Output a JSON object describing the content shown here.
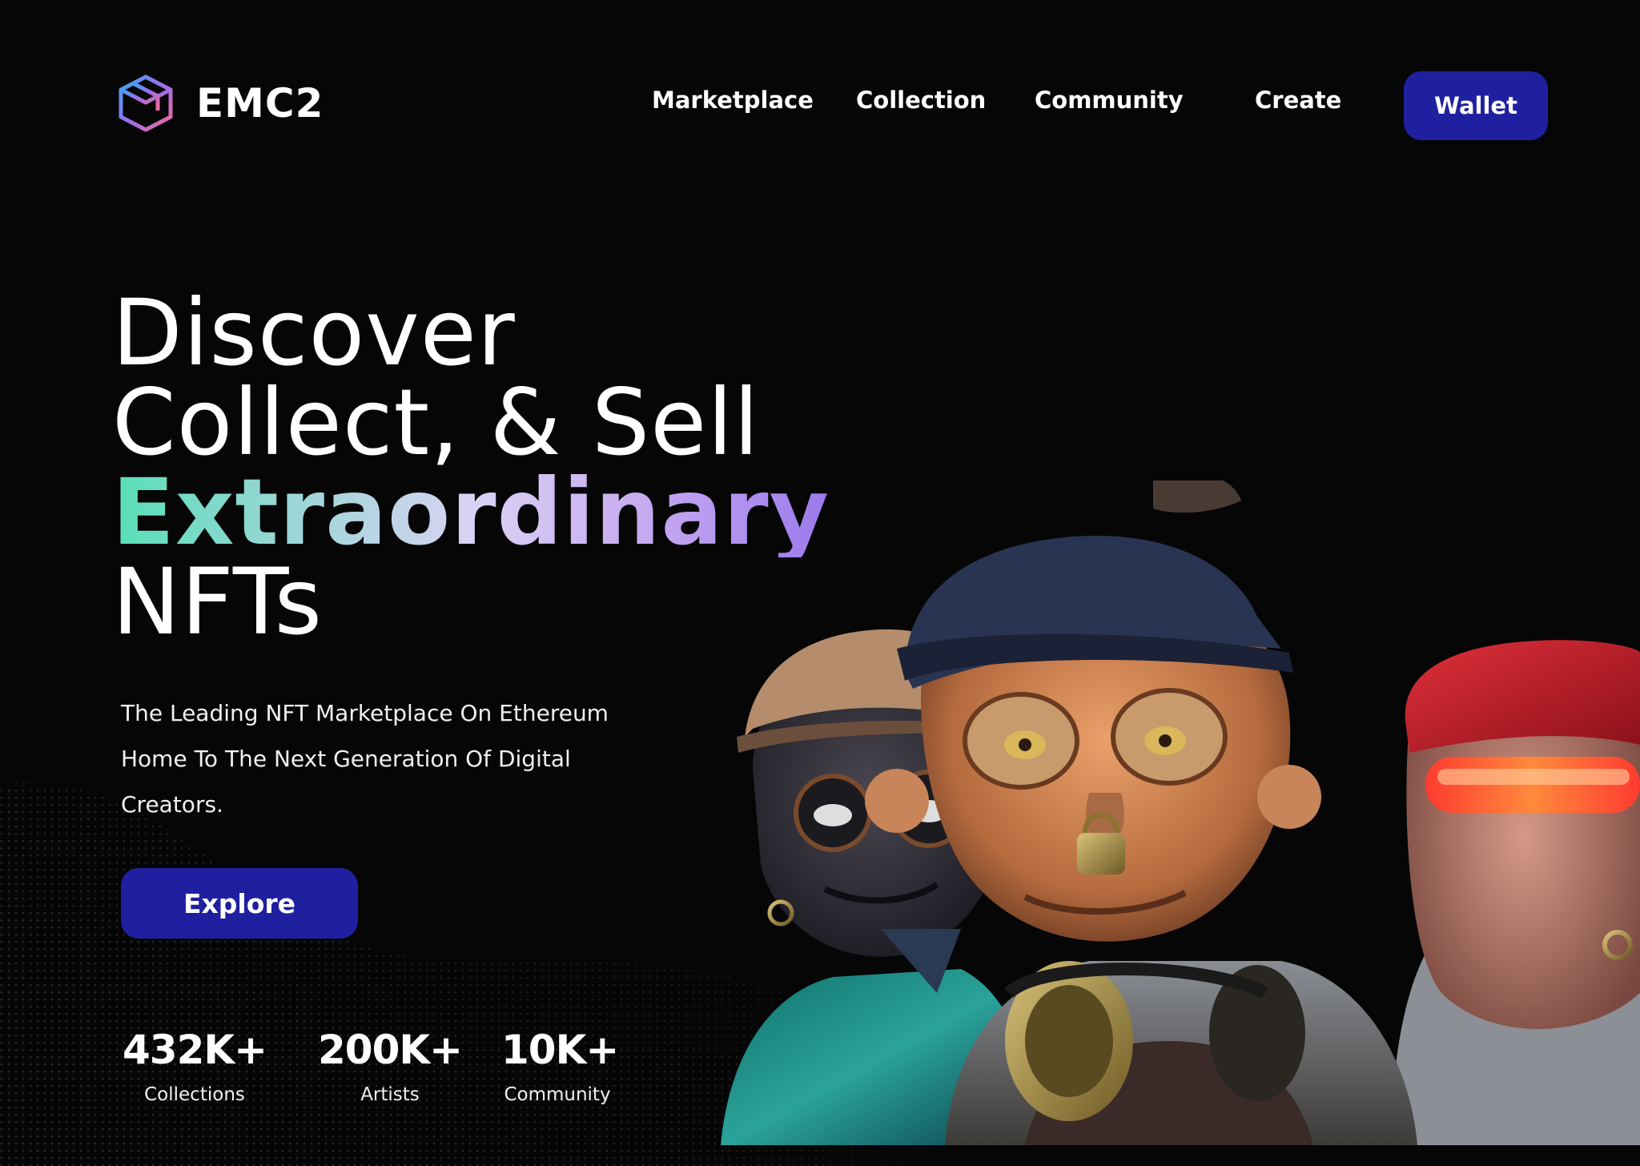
{
  "brand": {
    "name": "EMC2",
    "logo_icon": "isometric-cube-logo",
    "gradient": [
      "#3ba5f5",
      "#c25ae8",
      "#f36a9b"
    ]
  },
  "nav": {
    "items": [
      "Marketplace",
      "Collection",
      "Community",
      "Create"
    ],
    "wallet_label": "Wallet"
  },
  "hero": {
    "title_lines": [
      "Discover",
      "Collect, & Sell",
      "Extraordinary",
      "NFTs"
    ],
    "subtitle_lines": [
      "The Leading NFT Marketplace On Ethereum",
      "Home To The Next Generation Of Digital",
      "Creators."
    ],
    "explore_label": "Explore"
  },
  "stats": [
    {
      "value": "432K+",
      "label": "Collections"
    },
    {
      "value": "200K+",
      "label": "Artists"
    },
    {
      "value": "10K+",
      "label": "Community"
    }
  ],
  "colors": {
    "background": "#060607",
    "button": "#1f20a0",
    "accent_gradient": [
      "#57e0b7",
      "#d9d3f4",
      "#9b79ec"
    ]
  },
  "illustration": {
    "icon": "ape-nft-characters-illustration"
  }
}
